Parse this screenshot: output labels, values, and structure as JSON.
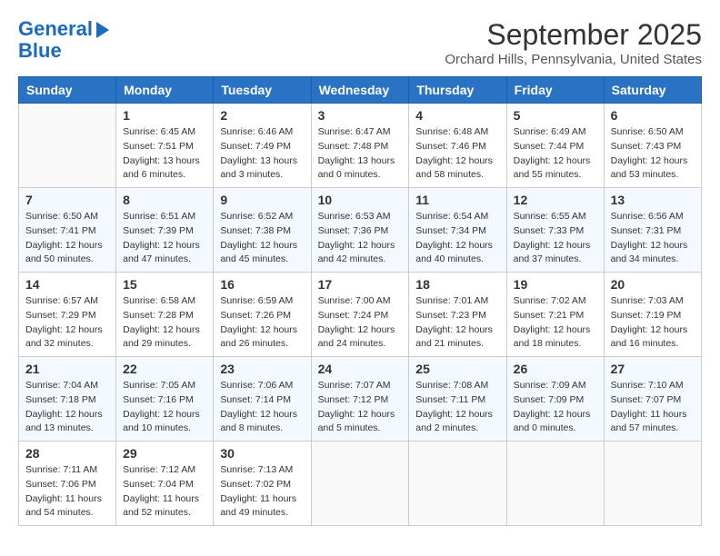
{
  "header": {
    "logo_line1": "General",
    "logo_line2": "Blue",
    "month": "September 2025",
    "location": "Orchard Hills, Pennsylvania, United States"
  },
  "weekdays": [
    "Sunday",
    "Monday",
    "Tuesday",
    "Wednesday",
    "Thursday",
    "Friday",
    "Saturday"
  ],
  "weeks": [
    [
      {
        "day": "",
        "empty": true
      },
      {
        "day": "1",
        "sunrise": "Sunrise: 6:45 AM",
        "sunset": "Sunset: 7:51 PM",
        "daylight": "Daylight: 13 hours and 6 minutes."
      },
      {
        "day": "2",
        "sunrise": "Sunrise: 6:46 AM",
        "sunset": "Sunset: 7:49 PM",
        "daylight": "Daylight: 13 hours and 3 minutes."
      },
      {
        "day": "3",
        "sunrise": "Sunrise: 6:47 AM",
        "sunset": "Sunset: 7:48 PM",
        "daylight": "Daylight: 13 hours and 0 minutes."
      },
      {
        "day": "4",
        "sunrise": "Sunrise: 6:48 AM",
        "sunset": "Sunset: 7:46 PM",
        "daylight": "Daylight: 12 hours and 58 minutes."
      },
      {
        "day": "5",
        "sunrise": "Sunrise: 6:49 AM",
        "sunset": "Sunset: 7:44 PM",
        "daylight": "Daylight: 12 hours and 55 minutes."
      },
      {
        "day": "6",
        "sunrise": "Sunrise: 6:50 AM",
        "sunset": "Sunset: 7:43 PM",
        "daylight": "Daylight: 12 hours and 53 minutes."
      }
    ],
    [
      {
        "day": "7",
        "sunrise": "Sunrise: 6:50 AM",
        "sunset": "Sunset: 7:41 PM",
        "daylight": "Daylight: 12 hours and 50 minutes."
      },
      {
        "day": "8",
        "sunrise": "Sunrise: 6:51 AM",
        "sunset": "Sunset: 7:39 PM",
        "daylight": "Daylight: 12 hours and 47 minutes."
      },
      {
        "day": "9",
        "sunrise": "Sunrise: 6:52 AM",
        "sunset": "Sunset: 7:38 PM",
        "daylight": "Daylight: 12 hours and 45 minutes."
      },
      {
        "day": "10",
        "sunrise": "Sunrise: 6:53 AM",
        "sunset": "Sunset: 7:36 PM",
        "daylight": "Daylight: 12 hours and 42 minutes."
      },
      {
        "day": "11",
        "sunrise": "Sunrise: 6:54 AM",
        "sunset": "Sunset: 7:34 PM",
        "daylight": "Daylight: 12 hours and 40 minutes."
      },
      {
        "day": "12",
        "sunrise": "Sunrise: 6:55 AM",
        "sunset": "Sunset: 7:33 PM",
        "daylight": "Daylight: 12 hours and 37 minutes."
      },
      {
        "day": "13",
        "sunrise": "Sunrise: 6:56 AM",
        "sunset": "Sunset: 7:31 PM",
        "daylight": "Daylight: 12 hours and 34 minutes."
      }
    ],
    [
      {
        "day": "14",
        "sunrise": "Sunrise: 6:57 AM",
        "sunset": "Sunset: 7:29 PM",
        "daylight": "Daylight: 12 hours and 32 minutes."
      },
      {
        "day": "15",
        "sunrise": "Sunrise: 6:58 AM",
        "sunset": "Sunset: 7:28 PM",
        "daylight": "Daylight: 12 hours and 29 minutes."
      },
      {
        "day": "16",
        "sunrise": "Sunrise: 6:59 AM",
        "sunset": "Sunset: 7:26 PM",
        "daylight": "Daylight: 12 hours and 26 minutes."
      },
      {
        "day": "17",
        "sunrise": "Sunrise: 7:00 AM",
        "sunset": "Sunset: 7:24 PM",
        "daylight": "Daylight: 12 hours and 24 minutes."
      },
      {
        "day": "18",
        "sunrise": "Sunrise: 7:01 AM",
        "sunset": "Sunset: 7:23 PM",
        "daylight": "Daylight: 12 hours and 21 minutes."
      },
      {
        "day": "19",
        "sunrise": "Sunrise: 7:02 AM",
        "sunset": "Sunset: 7:21 PM",
        "daylight": "Daylight: 12 hours and 18 minutes."
      },
      {
        "day": "20",
        "sunrise": "Sunrise: 7:03 AM",
        "sunset": "Sunset: 7:19 PM",
        "daylight": "Daylight: 12 hours and 16 minutes."
      }
    ],
    [
      {
        "day": "21",
        "sunrise": "Sunrise: 7:04 AM",
        "sunset": "Sunset: 7:18 PM",
        "daylight": "Daylight: 12 hours and 13 minutes."
      },
      {
        "day": "22",
        "sunrise": "Sunrise: 7:05 AM",
        "sunset": "Sunset: 7:16 PM",
        "daylight": "Daylight: 12 hours and 10 minutes."
      },
      {
        "day": "23",
        "sunrise": "Sunrise: 7:06 AM",
        "sunset": "Sunset: 7:14 PM",
        "daylight": "Daylight: 12 hours and 8 minutes."
      },
      {
        "day": "24",
        "sunrise": "Sunrise: 7:07 AM",
        "sunset": "Sunset: 7:12 PM",
        "daylight": "Daylight: 12 hours and 5 minutes."
      },
      {
        "day": "25",
        "sunrise": "Sunrise: 7:08 AM",
        "sunset": "Sunset: 7:11 PM",
        "daylight": "Daylight: 12 hours and 2 minutes."
      },
      {
        "day": "26",
        "sunrise": "Sunrise: 7:09 AM",
        "sunset": "Sunset: 7:09 PM",
        "daylight": "Daylight: 12 hours and 0 minutes."
      },
      {
        "day": "27",
        "sunrise": "Sunrise: 7:10 AM",
        "sunset": "Sunset: 7:07 PM",
        "daylight": "Daylight: 11 hours and 57 minutes."
      }
    ],
    [
      {
        "day": "28",
        "sunrise": "Sunrise: 7:11 AM",
        "sunset": "Sunset: 7:06 PM",
        "daylight": "Daylight: 11 hours and 54 minutes."
      },
      {
        "day": "29",
        "sunrise": "Sunrise: 7:12 AM",
        "sunset": "Sunset: 7:04 PM",
        "daylight": "Daylight: 11 hours and 52 minutes."
      },
      {
        "day": "30",
        "sunrise": "Sunrise: 7:13 AM",
        "sunset": "Sunset: 7:02 PM",
        "daylight": "Daylight: 11 hours and 49 minutes."
      },
      {
        "day": "",
        "empty": true
      },
      {
        "day": "",
        "empty": true
      },
      {
        "day": "",
        "empty": true
      },
      {
        "day": "",
        "empty": true
      }
    ]
  ]
}
